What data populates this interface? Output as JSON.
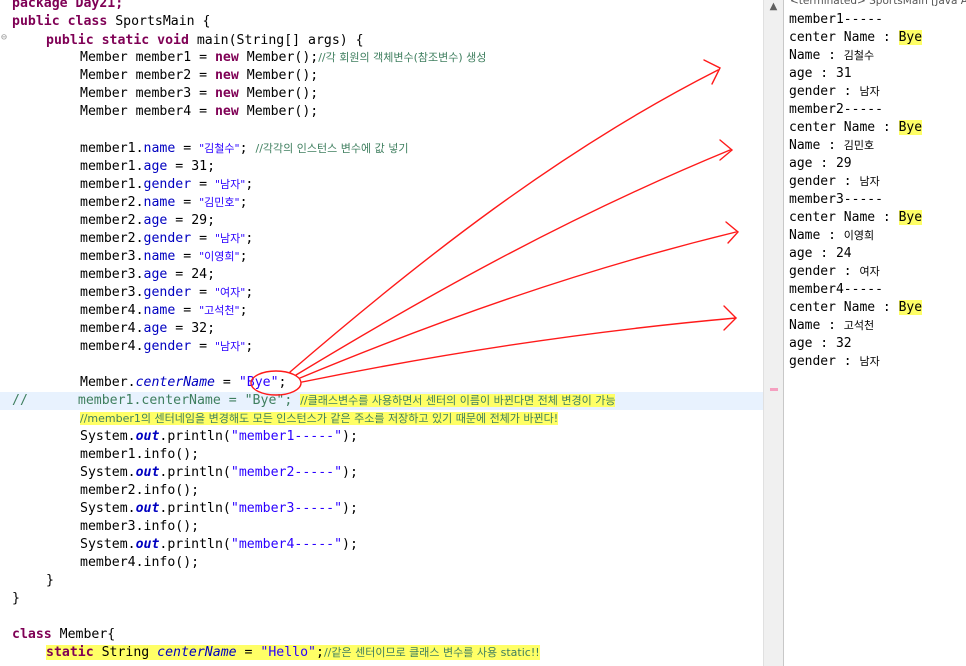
{
  "code": {
    "l0": "package Day21;",
    "l1_kw": "public class",
    "l1_rest": " SportsMain {",
    "l2_kw1": "public static void",
    "l2_rest": " main(String[] args) {",
    "decl": [
      {
        "type": "Member ",
        "var": "member1",
        "eq": " = ",
        "kw": "new",
        "call": " Member();",
        "comment": "//각 회원의 객체변수(참조변수) 생성"
      },
      {
        "type": "Member ",
        "var": "member2",
        "eq": " = ",
        "kw": "new",
        "call": " Member();",
        "comment": ""
      },
      {
        "type": "Member ",
        "var": "member3",
        "eq": " = ",
        "kw": "new",
        "call": " Member();",
        "comment": ""
      },
      {
        "type": "Member ",
        "var": "member4",
        "eq": " = ",
        "kw": "new",
        "call": " Member();",
        "comment": ""
      }
    ],
    "assign": [
      {
        "obj": "member1.",
        "field": "name",
        "eq": " = ",
        "str": "\"김철수\"",
        "end": "; ",
        "comment": "//각각의 인스턴스 변수에 값 넣기"
      },
      {
        "obj": "member1.",
        "field": "age",
        "eq": " = ",
        "str": "",
        "end": "31;",
        "comment": ""
      },
      {
        "obj": "member1.",
        "field": "gender",
        "eq": " = ",
        "str": "\"남자\"",
        "end": ";",
        "comment": ""
      },
      {
        "obj": "member2.",
        "field": "name",
        "eq": " = ",
        "str": "\"김민호\"",
        "end": ";",
        "comment": ""
      },
      {
        "obj": "member2.",
        "field": "age",
        "eq": " = ",
        "str": "",
        "end": "29;",
        "comment": ""
      },
      {
        "obj": "member2.",
        "field": "gender",
        "eq": " = ",
        "str": "\"남자\"",
        "end": ";",
        "comment": ""
      },
      {
        "obj": "member3.",
        "field": "name",
        "eq": " = ",
        "str": "\"이영희\"",
        "end": ";",
        "comment": ""
      },
      {
        "obj": "member3.",
        "field": "age",
        "eq": " = ",
        "str": "",
        "end": "24;",
        "comment": ""
      },
      {
        "obj": "member3.",
        "field": "gender",
        "eq": " = ",
        "str": "\"여자\"",
        "end": ";",
        "comment": ""
      },
      {
        "obj": "member4.",
        "field": "name",
        "eq": " = ",
        "str": "\"고석천\"",
        "end": ";",
        "comment": ""
      },
      {
        "obj": "member4.",
        "field": "age",
        "eq": " = ",
        "str": "",
        "end": "32;",
        "comment": ""
      },
      {
        "obj": "member4.",
        "field": "gender",
        "eq": " = ",
        "str": "\"남자\"",
        "end": ";",
        "comment": ""
      }
    ],
    "static_line": {
      "cls": "Member.",
      "field": "centerName",
      "eq": " = ",
      "str": "\"Bye\"",
      "end": ";"
    },
    "commented_line": {
      "slashes": "//",
      "code": "member1.centerName = \"Bye\"; ",
      "comment": "//클래스변수를 사용하면서 센터의 이름이 바뀐다면 전체 변경이 가능"
    },
    "comment_line": "//member1의 센터네임을 변경해도 모든 인스턴스가 같은 주소를 저장하고 있기 때문에 전체가 바뀐다!",
    "prints": [
      {
        "pre": "System.",
        "out": "out",
        "mid": ".println(",
        "str": "\"member1-----\"",
        "end": ");",
        "info": "member1.info();"
      },
      {
        "pre": "System.",
        "out": "out",
        "mid": ".println(",
        "str": "\"member2-----\"",
        "end": ");",
        "info": "member2.info();"
      },
      {
        "pre": "System.",
        "out": "out",
        "mid": ".println(",
        "str": "\"member3-----\"",
        "end": ");",
        "info": "member3.info();"
      },
      {
        "pre": "System.",
        "out": "out",
        "mid": ".println(",
        "str": "\"member4-----\"",
        "end": ");",
        "info": "member4.info();"
      }
    ],
    "close_method": "}",
    "close_class": "}",
    "class2_kw": "class",
    "class2_rest": " Member{",
    "field_decl": {
      "kw": "static",
      "type": " String ",
      "name": "centerName",
      "eq": " = ",
      "str": "\"Hello\"",
      "end": ";",
      "comment": "//같은 센터이므로 클래스 변수를 사용 static!!"
    }
  },
  "console": {
    "title": "<terminated> SportsMain [Java Application]",
    "blocks": [
      {
        "header": "member1-----",
        "center_label": "center Name : ",
        "center_value": "Bye",
        "name_label": "Name : ",
        "name": "김철수",
        "age_label": "age : ",
        "age": "31",
        "gender_label": "gender : ",
        "gender": "남자"
      },
      {
        "header": "member2-----",
        "center_label": "center Name : ",
        "center_value": "Bye",
        "name_label": "Name : ",
        "name": "김민호",
        "age_label": "age : ",
        "age": "29",
        "gender_label": "gender : ",
        "gender": "남자"
      },
      {
        "header": "member3-----",
        "center_label": "center Name : ",
        "center_value": "Bye",
        "name_label": "Name : ",
        "name": "이영희",
        "age_label": "age : ",
        "age": "24",
        "gender_label": "gender : ",
        "gender": "여자"
      },
      {
        "header": "member4-----",
        "center_label": "center Name : ",
        "center_value": "Bye",
        "name_label": "Name : ",
        "name": "고석천",
        "age_label": "age : ",
        "age": "32",
        "gender_label": "gender : ",
        "gender": "남자"
      }
    ]
  },
  "colors": {
    "keyword": "#7f0055",
    "string": "#2a00ff",
    "field": "#0000c0",
    "comment": "#3f7f5f",
    "highlight": "#ffff66",
    "annotation": "#ff0000"
  }
}
